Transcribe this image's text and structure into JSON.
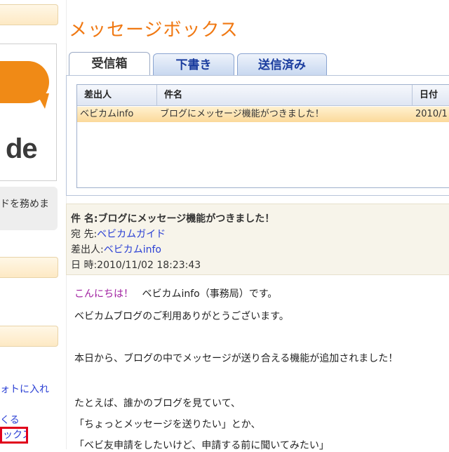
{
  "sidebar": {
    "name_text": "",
    "logo_text": "de",
    "desc_text": "ドを務めま",
    "link_1": "",
    "link_2": "",
    "link_3": "ォトに入れ",
    "link_4": "くる",
    "link_active": "ックス"
  },
  "colors": {
    "accent": "#f07812",
    "link": "#2a3fd4",
    "highlight_row": "#fbd99a",
    "active_marker": "#e0001b"
  },
  "page": {
    "title": "メッセージボックス"
  },
  "tabs": [
    {
      "label": "受信箱",
      "active": true
    },
    {
      "label": "下書き",
      "active": false
    },
    {
      "label": "送信済み",
      "active": false
    }
  ],
  "list": {
    "headers": {
      "sender": "差出人",
      "subject": "件名",
      "date": "日付"
    },
    "rows": [
      {
        "sender": "ベビカムinfo",
        "subject": "ブログにメッセージ機能がつきました！",
        "date": "2010/1"
      }
    ]
  },
  "message": {
    "subject_label": "件 名:",
    "subject": "ブログにメッセージ機能がつきました！",
    "to_label": "宛 先:",
    "to": "ベビカムガイド",
    "from_label": "差出人:",
    "from": "ベビカムinfo",
    "date_label": "日 時:",
    "date": "2010/11/02 18:23:43",
    "greeting": "こんにちは！",
    "body_lines": [
      "ベビカムinfo（事務局）です。",
      "ベビカムブログのご利用ありがとうございます。",
      "本日から、ブログの中でメッセージが送り合える機能が追加されました！",
      "たとえば、誰かのブログを見ていて、",
      "「ちょっとメッセージを送りたい」とか、",
      "「ベビ友申請をしたいけど、申請する前に聞いてみたい」"
    ]
  }
}
